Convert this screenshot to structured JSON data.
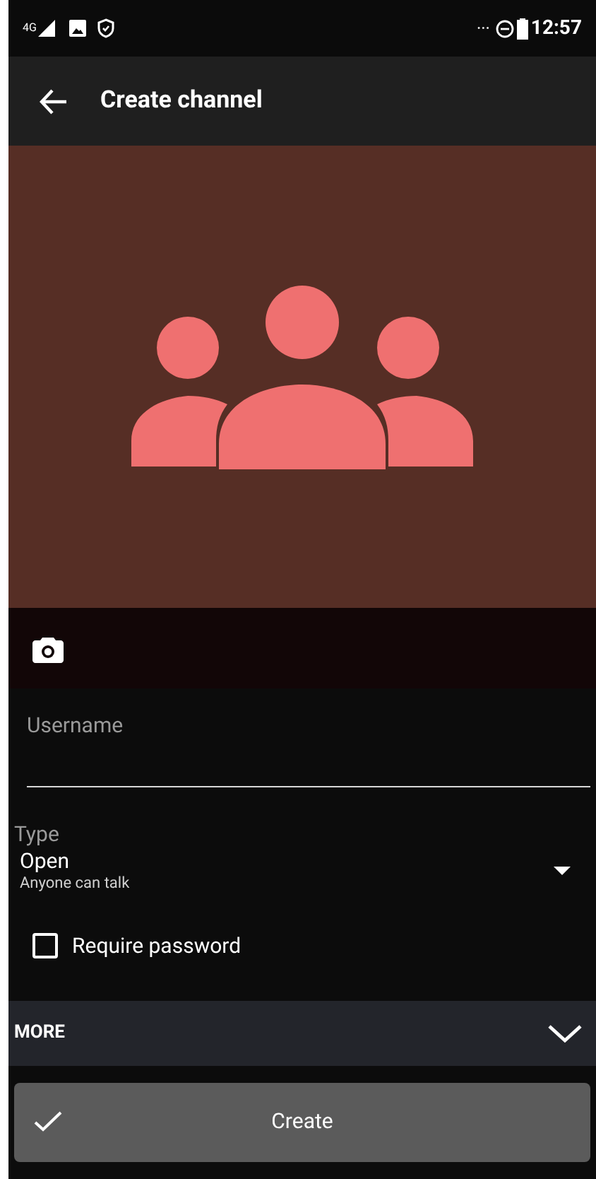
{
  "status_bar": {
    "network": "4G",
    "time": "12:57",
    "more": "···"
  },
  "app_bar": {
    "title": "Create channel"
  },
  "avatar": {
    "kind": "group"
  },
  "form": {
    "username": {
      "placeholder": "Username"
    },
    "type": {
      "label": "Type",
      "value": "Open",
      "description": "Anyone can talk"
    },
    "require_password": {
      "label": "Require password",
      "checked": false
    }
  },
  "more": {
    "label": "MORE",
    "expanded": false
  },
  "create_button": {
    "label": "Create"
  }
}
